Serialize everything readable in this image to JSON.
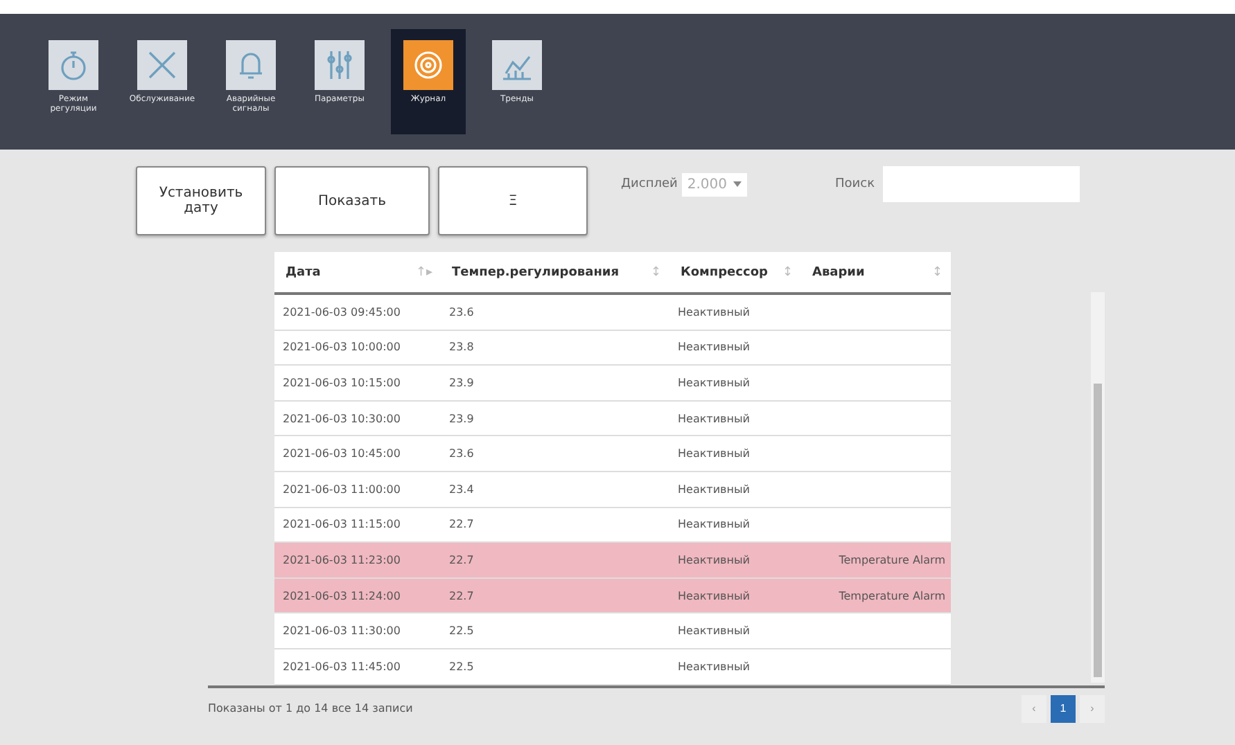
{
  "nav": [
    {
      "label": "Режим регуляции",
      "selected": false
    },
    {
      "label": "Обслуживание",
      "selected": false
    },
    {
      "label": "Аварийные сигналы",
      "selected": false
    },
    {
      "label": "Параметры",
      "selected": false
    },
    {
      "label": "Журнал",
      "selected": true
    },
    {
      "label": "Тренды",
      "selected": false
    }
  ],
  "toolbar": {
    "buttons": [
      "Установить дату",
      "Показать",
      "Ξ"
    ],
    "display_label": "Дисплей",
    "display_value": "2.000",
    "search_label": "Поиск"
  },
  "table": {
    "columns": [
      {
        "label": "Дата",
        "sort": "↑▸"
      },
      {
        "label": "Темпер.регулирования",
        "sort": "↕"
      },
      {
        "label": "Компрессор",
        "sort": "↕"
      },
      {
        "label": "Аварии",
        "sort": "↕"
      }
    ],
    "rows": [
      {
        "cells": [
          "2021-06-03 09:45:00",
          "23.6",
          "Неактивный",
          ""
        ],
        "alarm": false
      },
      {
        "cells": [
          "2021-06-03 10:00:00",
          "23.8",
          "Неактивный",
          ""
        ],
        "alarm": false
      },
      {
        "cells": [
          "2021-06-03 10:15:00",
          "23.9",
          "Неактивный",
          ""
        ],
        "alarm": false
      },
      {
        "cells": [
          "2021-06-03 10:30:00",
          "23.9",
          "Неактивный",
          ""
        ],
        "alarm": false
      },
      {
        "cells": [
          "2021-06-03 10:45:00",
          "23.6",
          "Неактивный",
          ""
        ],
        "alarm": false
      },
      {
        "cells": [
          "2021-06-03 11:00:00",
          "23.4",
          "Неактивный",
          ""
        ],
        "alarm": false
      },
      {
        "cells": [
          "2021-06-03 11:15:00",
          "22.7",
          "Неактивный",
          ""
        ],
        "alarm": false
      },
      {
        "cells": [
          "2021-06-03 11:23:00",
          "22.7",
          "Неактивный",
          "Temperature Alarm"
        ],
        "alarm": true
      },
      {
        "cells": [
          "2021-06-03 11:24:00",
          "22.7",
          "Неактивный",
          "Temperature Alarm"
        ],
        "alarm": true
      },
      {
        "cells": [
          "2021-06-03 11:30:00",
          "22.5",
          "Неактивный",
          ""
        ],
        "alarm": false
      },
      {
        "cells": [
          "2021-06-03 11:45:00",
          "22.5",
          "Неактивный",
          ""
        ],
        "alarm": false
      }
    ]
  },
  "footer": {
    "info": "Показаны от 1 до 14 все 14 записи",
    "pages": [
      {
        "label": "‹",
        "selected": false
      },
      {
        "label": "1",
        "selected": true
      },
      {
        "label": "›",
        "selected": false
      }
    ]
  }
}
